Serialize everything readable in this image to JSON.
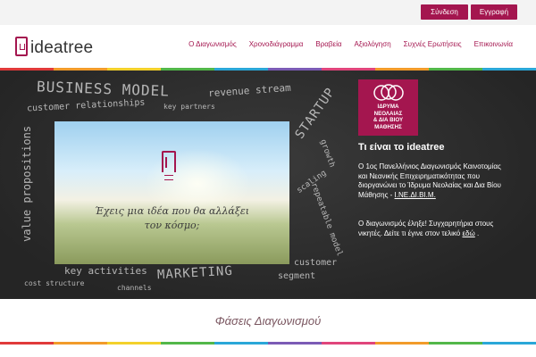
{
  "topbar": {
    "login_label": "Σύνδεση",
    "register_label": "Εγγραφή"
  },
  "header": {
    "logo_text": "ideatree",
    "nav": [
      "Ο Διαγωνισμός",
      "Χρονοδιάγραμμα",
      "Βραβεία",
      "Αξιολόγηση",
      "Συχνές Ερωτήσεις",
      "Επικοινωνία"
    ]
  },
  "board": {
    "chalk": {
      "business_model": "BUSINESS MODEL",
      "revenue_stream": "revenue stream",
      "customer_relationships": "customer relationships",
      "key_partners": "key partners",
      "value_propositions": "value propositions",
      "startup": "STARTUP",
      "growth": "growth",
      "scaling": "scaling",
      "repeatable_model": "repeatable model",
      "key_activities": "key activities",
      "marketing": "MARKETING",
      "customer_segment_1": "customer",
      "customer_segment_2": "segment",
      "cost_structure": "cost structure",
      "channels": "channels"
    },
    "hero_text_line1": "Έχεις μια ιδέα που θα αλλάξει",
    "hero_text_line2": "τον κόσμο;"
  },
  "badge": {
    "line1": "ΙΔΡΥΜΑ",
    "line2": "ΝΕΟΛΑΙΑΣ",
    "line3": "& ΔΙΑ ΒΙΟΥ",
    "line4": "ΜΑΘΗΣΗΣ"
  },
  "panel": {
    "title": "Τι είναι το ideatree",
    "p1_text": "Ο 1ος Πανελλήνιος Διαγωνισμός Καινοτομίας και Νεανικής Επιχειρηματικότητας που διοργανώνει το Ίδρυμα Νεολαίας και Δια Βίου Μάθησης - ",
    "p1_link": "Ι.ΝΕ.ΔΙ.ΒΙ.Μ.",
    "p2_text": "Ο διαγωνισμός έληξε! Συγχαρητήρια στους νικητές. Δείτε τι έγινε στον τελικό ",
    "p2_link": "εδώ",
    "p2_end": " ."
  },
  "section": {
    "title": "Φάσεις Διαγωνισμού"
  },
  "colors": {
    "brand": "#a4164f",
    "board": "#2d2d2d"
  }
}
